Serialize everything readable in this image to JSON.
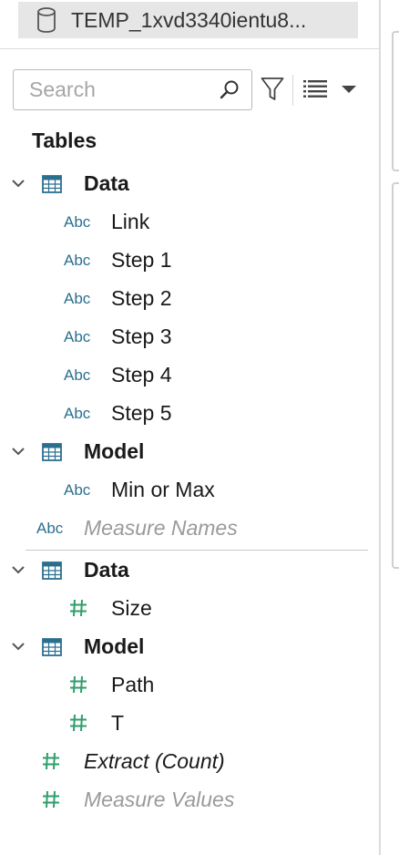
{
  "datasource": {
    "name": "TEMP_1xvd3340ientu8..."
  },
  "search": {
    "placeholder": "Search",
    "value": ""
  },
  "toolbar": {
    "filter_icon": "filter-icon",
    "view_icon": "list-view-icon",
    "menu_icon": "caret-down-icon"
  },
  "data_pane": {
    "heading": "Tables",
    "dimensions": [
      {
        "table": "Data",
        "fields": [
          "Link",
          "Step 1",
          "Step 2",
          "Step 3",
          "Step 4",
          "Step 5"
        ]
      },
      {
        "table": "Model",
        "fields": [
          "Min or Max"
        ]
      }
    ],
    "measure_names": "Measure Names",
    "measures": [
      {
        "table": "Data",
        "fields": [
          "Size"
        ]
      },
      {
        "table": "Model",
        "fields": [
          "Path",
          "T"
        ]
      }
    ],
    "extract_count": "Extract (Count)",
    "measure_values": "Measure Values",
    "type_badge": "Abc"
  },
  "colors": {
    "dimension": "#2b6f8f",
    "measure": "#2e9e6b",
    "selection_bg": "#e6e6e6"
  }
}
